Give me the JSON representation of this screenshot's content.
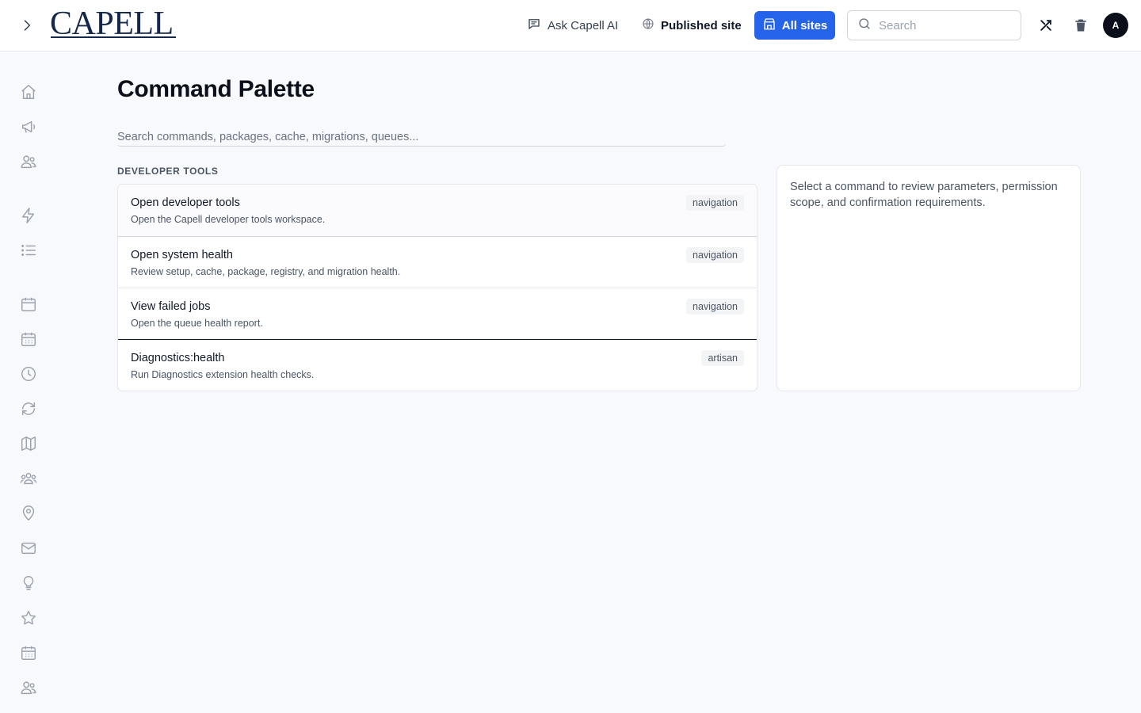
{
  "header": {
    "logo_text": "CAPELL",
    "ask_ai_label": "Ask Capell AI",
    "published_site_label": "Published site",
    "all_sites_label": "All sites",
    "search_placeholder": "Search",
    "avatar_initial": "A"
  },
  "sidebar": {
    "icons": [
      "home-icon",
      "megaphone-icon",
      "users-icon",
      "bolt-icon",
      "list-icon",
      "calendar-icon",
      "calendar-grid-icon",
      "clock-icon",
      "refresh-icon",
      "map-icon",
      "user-group-icon",
      "map-pin-icon",
      "mail-icon",
      "lightbulb-icon",
      "star-icon",
      "calendar-days-icon",
      "users-alt-icon"
    ]
  },
  "main": {
    "title": "Command Palette",
    "search_placeholder": "Search commands, packages, cache, migrations, queues...",
    "section_label": "DEVELOPER TOOLS",
    "commands": [
      {
        "title": "Open developer tools",
        "description": "Open the Capell developer tools workspace.",
        "badge": "navigation"
      },
      {
        "title": "Open system health",
        "description": "Review setup, cache, package, registry, and migration health.",
        "badge": "navigation"
      },
      {
        "title": "View failed jobs",
        "description": "Open the queue health report.",
        "badge": "navigation"
      },
      {
        "title": "Diagnostics:health",
        "description": "Run Diagnostics extension health checks.",
        "badge": "artisan"
      }
    ],
    "detail_text": "Select a command to review parameters, permission scope, and confirmation requirements."
  },
  "colors": {
    "accent": "#2563eb",
    "brand": "#14284b",
    "background": "#f8f9fc"
  }
}
